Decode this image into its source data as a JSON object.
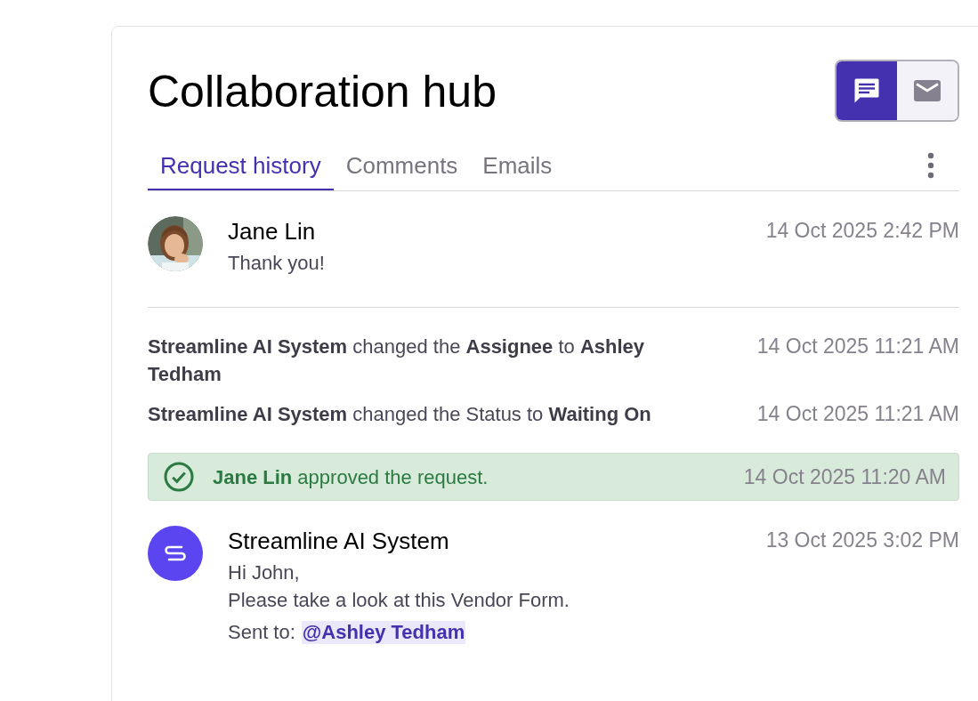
{
  "title": "Collaboration hub",
  "view_toggle": [
    {
      "kind": "chat",
      "selected": true
    },
    {
      "kind": "mail",
      "selected": false
    }
  ],
  "tabs": [
    {
      "label": "Request history",
      "selected": true
    },
    {
      "label": "Comments",
      "selected": false
    },
    {
      "label": "Emails",
      "selected": false
    }
  ],
  "feed": [
    {
      "kind": "message",
      "avatar": {
        "kind": "picture"
      },
      "author": "Jane Lin",
      "time": "14 Oct 2025 2:42 PM",
      "lines": [
        "Thank you!"
      ]
    },
    {
      "kind": "event",
      "text": "**Streamline AI System** changed the **Assignee** to **Ashley Tedham**",
      "time": "14 Oct 2025 11:21 AM"
    },
    {
      "kind": "event",
      "text": "**Streamline AI System** changed the Status to **Waiting On**",
      "time": "14 Oct 2025 11:21 AM"
    },
    {
      "kind": "approval",
      "text": "**Jane Lin** approved the request.",
      "time": "14 Oct 2025 11:20 AM"
    },
    {
      "kind": "message",
      "avatar": {
        "kind": "logo"
      },
      "author": "Streamline AI System",
      "time": "13 Oct 2025 3:02 PM",
      "lines": [
        "Hi John,",
        "Please take a look at this Vendor Form."
      ],
      "sent_to_label": "Sent to:",
      "mention": "@Ashley Tedham"
    }
  ]
}
